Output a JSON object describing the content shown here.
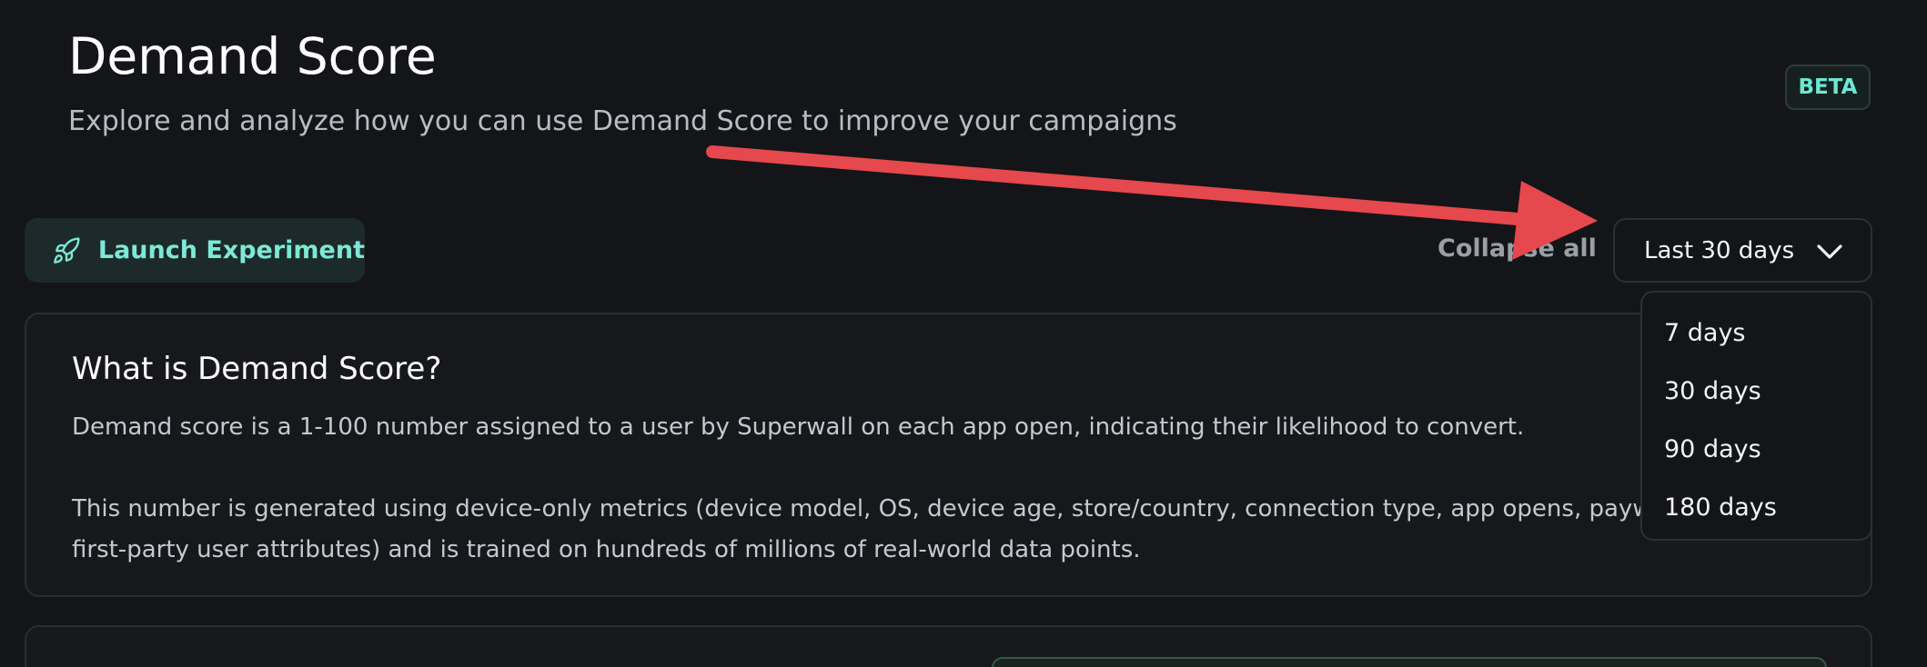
{
  "header": {
    "title": "Demand Score",
    "subtitle": "Explore and analyze how you can use Demand Score to improve your campaigns",
    "badge": "BETA"
  },
  "toolbar": {
    "launch_label": "Launch Experiment",
    "launch_icon": "rocket-icon",
    "collapse_label": "Collapse all",
    "range_value": "Last 30 days",
    "range_icon": "chevron-down-icon"
  },
  "range_menu": {
    "options": [
      "7 days",
      "30 days",
      "90 days",
      "180 days"
    ]
  },
  "info_card": {
    "heading": "What is Demand Score?",
    "paragraph1": "Demand score is a 1-100 number assigned to a user by Superwall on each app open, indicating their likelihood to convert.",
    "paragraph2_line1": "This number is generated using device-only metrics (device model, OS, device age, store/country, connection type, app opens, paywa",
    "paragraph2_line2": "first-party user attributes) and is trained on hundreds of millions of real-world data points."
  },
  "colors": {
    "accent": "#7de8d6",
    "annotation_arrow": "#e5484d",
    "background": "#141518"
  }
}
